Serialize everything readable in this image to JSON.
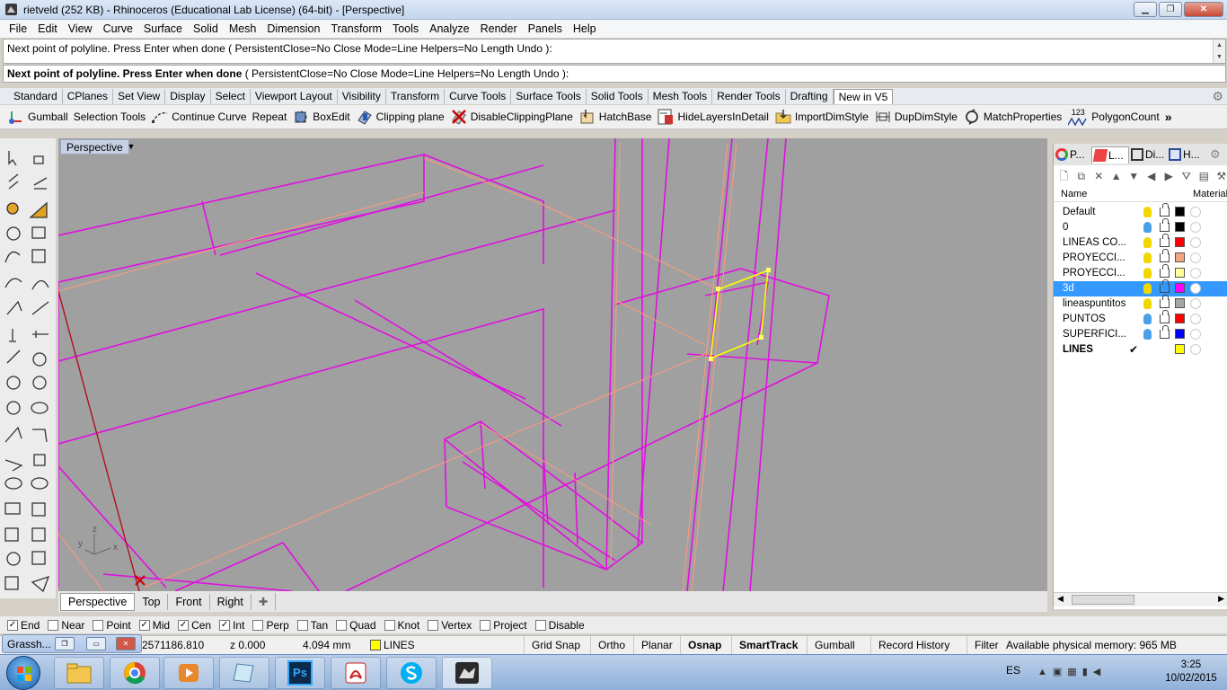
{
  "window": {
    "title": "rietveld (252 KB) - Rhinoceros (Educational Lab License) (64-bit) - [Perspective]"
  },
  "menu": [
    "File",
    "Edit",
    "View",
    "Curve",
    "Surface",
    "Solid",
    "Mesh",
    "Dimension",
    "Transform",
    "Tools",
    "Analyze",
    "Render",
    "Panels",
    "Help"
  ],
  "command": {
    "history": "Next point of polyline. Press Enter when done ( PersistentClose=No  Close  Mode=Line  Helpers=No  Length  Undo ):",
    "prompt_prefix": "Next point of polyline. Press Enter when done",
    "prompt_options": " ( PersistentClose=No  Close  Mode=Line  Helpers=No  Length  Undo ):"
  },
  "toolbar_tabs": [
    "Standard",
    "CPlanes",
    "Set View",
    "Display",
    "Select",
    "Viewport Layout",
    "Visibility",
    "Transform",
    "Curve Tools",
    "Surface Tools",
    "Solid Tools",
    "Mesh Tools",
    "Render Tools",
    "Drafting",
    "New in V5"
  ],
  "toolbar_tabs_active": "New in V5",
  "toolbar_buttons": [
    {
      "label": "Gumball",
      "icon": "gumball-icon"
    },
    {
      "label": "Selection Tools",
      "icon": "selection-tools-icon"
    },
    {
      "label": "Continue Curve",
      "icon": "continue-curve-icon"
    },
    {
      "label": "Repeat",
      "icon": "repeat-icon"
    },
    {
      "label": "BoxEdit",
      "icon": "boxedit-icon"
    },
    {
      "label": "Clipping plane",
      "icon": "clipping-plane-icon"
    },
    {
      "label": "DisableClippingPlane",
      "icon": "disable-clipping-plane-icon"
    },
    {
      "label": "HatchBase",
      "icon": "hatchbase-icon"
    },
    {
      "label": "HideLayersInDetail",
      "icon": "hide-layers-icon"
    },
    {
      "label": "ImportDimStyle",
      "icon": "import-dimstyle-icon"
    },
    {
      "label": "DupDimStyle",
      "icon": "dup-dimstyle-icon"
    },
    {
      "label": "MatchProperties",
      "icon": "match-properties-icon"
    },
    {
      "label": "PolygonCount",
      "icon": "polygon-count-icon"
    }
  ],
  "toolbar_more": "»",
  "polygon_count_badge": "123",
  "viewport": {
    "label": "Perspective",
    "axis_x": "x",
    "axis_y": "y",
    "axis_z": "z"
  },
  "viewport_tabs": [
    "Perspective",
    "Top",
    "Front",
    "Right"
  ],
  "viewport_tabs_active": "Perspective",
  "panel_tabs": [
    {
      "label": "P...",
      "icon": "properties-icon"
    },
    {
      "label": "L...",
      "icon": "layers-icon"
    },
    {
      "label": "Di...",
      "icon": "display-icon"
    },
    {
      "label": "H...",
      "icon": "help-icon"
    }
  ],
  "layers": {
    "header_name": "Name",
    "header_material": "Material",
    "rows": [
      {
        "name": "Default",
        "color": "#000000",
        "bulb": "#f2d600"
      },
      {
        "name": "0",
        "color": "#000000",
        "bulb": "#4aa0e8"
      },
      {
        "name": "LINEAS CO...",
        "color": "#ff0000",
        "bulb": "#f2d600"
      },
      {
        "name": "PROYECCI...",
        "color": "#f4a582",
        "bulb": "#f2d600"
      },
      {
        "name": "PROYECCI...",
        "color": "#ffff99",
        "bulb": "#f2d600"
      },
      {
        "name": "3d",
        "color": "#ff00ff",
        "bulb": "#f2d600",
        "selected": true
      },
      {
        "name": "lineaspuntitos",
        "color": "#a6a6a6",
        "bulb": "#f2d600"
      },
      {
        "name": "PUNTOS",
        "color": "#ff0000",
        "bulb": "#4aa0e8"
      },
      {
        "name": "SUPERFICI...",
        "color": "#0000ff",
        "bulb": "#4aa0e8"
      },
      {
        "name": "LINES",
        "color": "#ffff00",
        "current": true,
        "check": "✔"
      }
    ]
  },
  "osnap": [
    {
      "label": "End",
      "checked": true
    },
    {
      "label": "Near",
      "checked": false
    },
    {
      "label": "Point",
      "checked": false
    },
    {
      "label": "Mid",
      "checked": true
    },
    {
      "label": "Cen",
      "checked": true
    },
    {
      "label": "Int",
      "checked": true
    },
    {
      "label": "Perp",
      "checked": false
    },
    {
      "label": "Tan",
      "checked": false
    },
    {
      "label": "Quad",
      "checked": false
    },
    {
      "label": "Knot",
      "checked": false
    },
    {
      "label": "Vertex",
      "checked": false
    },
    {
      "label": "Project",
      "checked": false
    },
    {
      "label": "Disable",
      "checked": false
    }
  ],
  "status": {
    "y_coord": "2571186.810",
    "z_coord": "z 0.000",
    "distance": "4.094 mm",
    "layer": "LINES",
    "layer_color": "#ffff00",
    "buttons": [
      {
        "label": "Grid Snap",
        "bold": false
      },
      {
        "label": "Ortho",
        "bold": false
      },
      {
        "label": "Planar",
        "bold": false
      },
      {
        "label": "Osnap",
        "bold": true
      },
      {
        "label": "SmartTrack",
        "bold": true
      },
      {
        "label": "Gumball",
        "bold": false
      },
      {
        "label": "Record History",
        "bold": false
      },
      {
        "label": "Filter",
        "bold": false
      }
    ],
    "memory": "Available physical memory: 965 MB"
  },
  "grasshopper": {
    "title": "Grassh..."
  },
  "taskbar": {
    "apps": [
      "explorer-icon",
      "chrome-icon",
      "media-player-icon",
      "notes-icon",
      "photoshop-icon",
      "acrobat-icon",
      "skype-icon",
      "rhino-icon"
    ],
    "ps_text": "Ps",
    "lang": "ES",
    "time": "3:25",
    "date": "10/02/2015"
  }
}
